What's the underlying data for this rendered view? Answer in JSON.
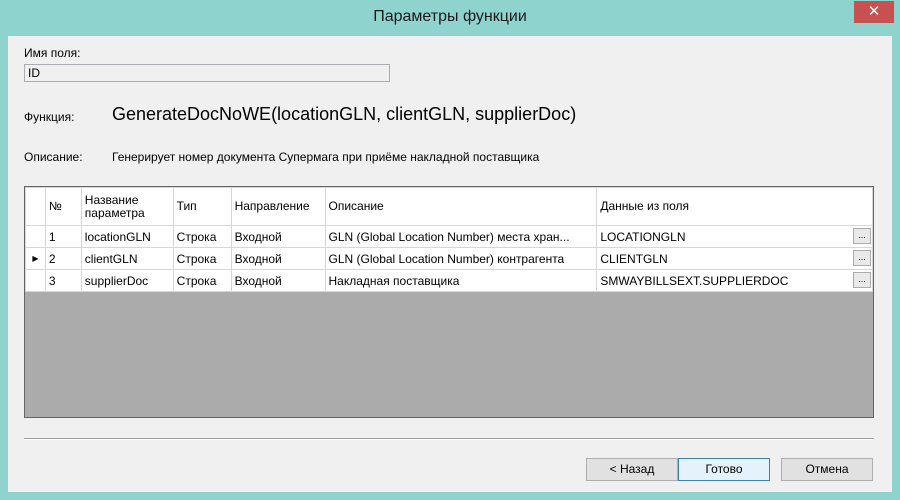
{
  "window": {
    "title": "Параметры функции",
    "close_glyph": "✕"
  },
  "form": {
    "field_name_label": "Имя поля:",
    "field_name_value": "ID",
    "function_label": "Функция:",
    "function_signature": "GenerateDocNoWE(locationGLN, clientGLN, supplierDoc)",
    "description_label": "Описание:",
    "description_text": "Генерирует номер документа Супермага при приёме накладной поставщика"
  },
  "grid": {
    "headers": {
      "num": "№",
      "name": "Название параметра",
      "type": "Тип",
      "direction": "Направление",
      "description": "Описание",
      "data_field": "Данные из поля"
    },
    "current_row_marker": "▶",
    "ellipsis_label": "...",
    "rows": [
      {
        "num": "1",
        "name": "locationGLN",
        "type": "Строка",
        "direction": "Входной",
        "description": "GLN (Global Location Number) места хран...",
        "data_field": "LOCATIONGLN"
      },
      {
        "num": "2",
        "name": "clientGLN",
        "type": "Строка",
        "direction": "Входной",
        "description": "GLN (Global Location Number) контрагента",
        "data_field": "CLIENTGLN"
      },
      {
        "num": "3",
        "name": "supplierDoc",
        "type": "Строка",
        "direction": "Входной",
        "description": "Накладная поставщика",
        "data_field": "SMWAYBILLSEXT.SUPPLIERDOC"
      }
    ]
  },
  "buttons": {
    "back": "< Назад",
    "done": "Готово",
    "cancel": "Отмена"
  },
  "colors": {
    "titlebar": "#8fd3cf",
    "close_button": "#c75050",
    "grid_background": "#ababab"
  }
}
